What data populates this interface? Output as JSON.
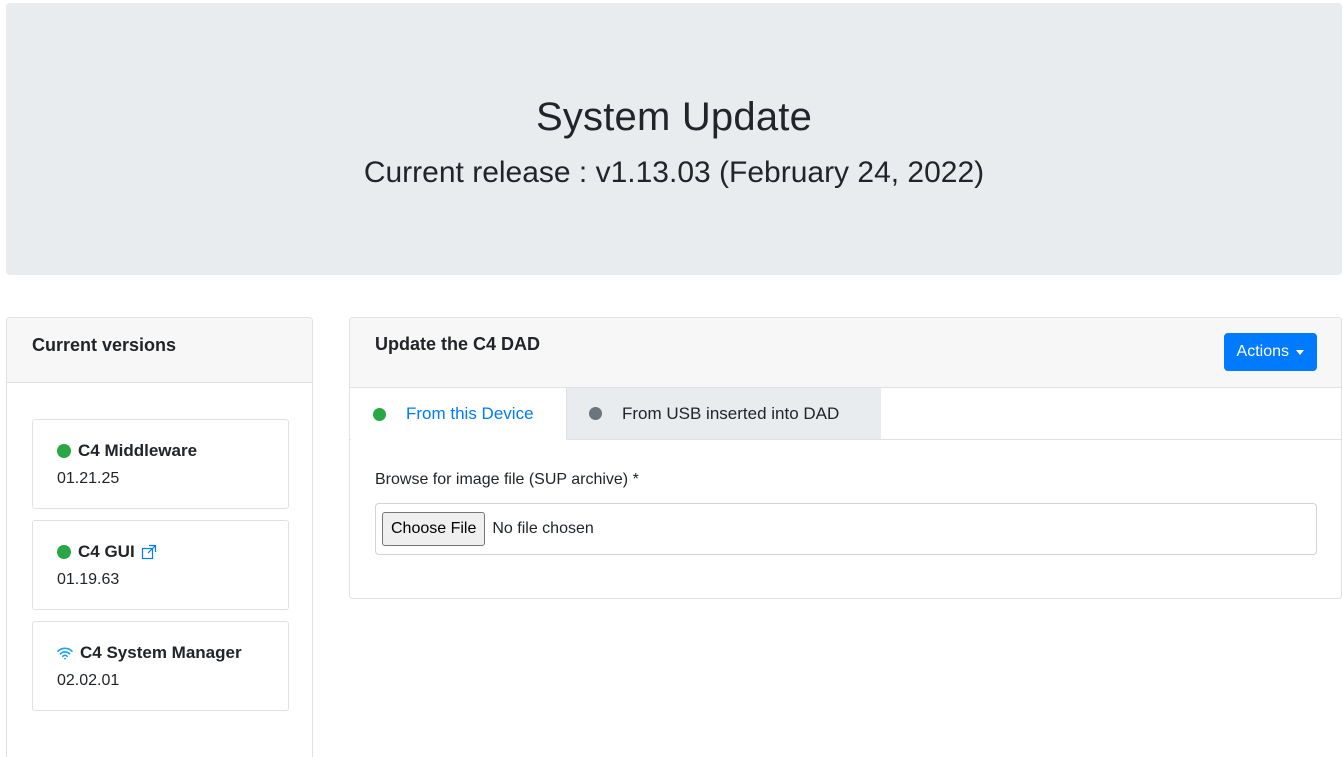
{
  "header": {
    "title": "System Update",
    "subtitle": "Current release : v1.13.03 (February 24, 2022)"
  },
  "versions": {
    "title": "Current versions",
    "items": [
      {
        "name": "C4 Middleware",
        "value": "01.21.25",
        "status_icon": "green-dot-icon"
      },
      {
        "name": "C4 GUI",
        "value": "01.19.63",
        "status_icon": "green-dot-icon",
        "extra_icon": "external-link-icon"
      },
      {
        "name": "C4 System Manager",
        "value": "02.02.01",
        "status_icon": "wifi-icon"
      }
    ]
  },
  "update": {
    "title": "Update the C4 DAD",
    "actions_label": "Actions",
    "tabs": [
      {
        "label": "From this Device",
        "active": true,
        "dot_color": "#28a745"
      },
      {
        "label": "From USB inserted into DAD",
        "active": false,
        "dot_color": "#6c757d"
      }
    ],
    "file_label": "Browse for image file (SUP archive) *",
    "choose_button": "Choose File",
    "file_status": "No file chosen"
  },
  "colors": {
    "primary": "#007bff",
    "success": "#28a745",
    "secondary": "#6c757d",
    "jumbotron_bg": "#e9ecef"
  }
}
